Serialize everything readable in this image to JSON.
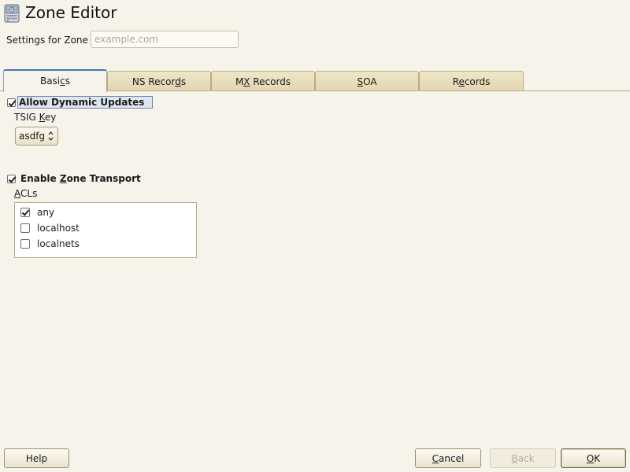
{
  "app": {
    "title": "Zone Editor",
    "icon": "server-icon"
  },
  "zone": {
    "label": "Settings for Zone",
    "placeholder": "example.com",
    "value": ""
  },
  "tabs": [
    {
      "pre": "Basi",
      "key": "c",
      "post": "s",
      "active": true
    },
    {
      "pre": "NS Recor",
      "key": "d",
      "post": "s",
      "active": false
    },
    {
      "pre": "M",
      "key": "X",
      "post": " Records",
      "active": false
    },
    {
      "pre": "",
      "key": "S",
      "post": "OA",
      "active": false
    },
    {
      "pre": "R",
      "key": "e",
      "post": "cords",
      "active": false
    }
  ],
  "dynamic_updates": {
    "label": "Allow Dynamic Updates",
    "checked": true
  },
  "tsig": {
    "label_pre": "TSIG ",
    "label_key": "K",
    "label_post": "ey",
    "selected": "asdfg"
  },
  "zone_transport": {
    "label_pre": "Enable ",
    "label_key": "Z",
    "label_post": "one Transport",
    "checked": true
  },
  "acls": {
    "label_key": "A",
    "label_post": "CLs",
    "items": [
      {
        "label": "any",
        "checked": true
      },
      {
        "label": "localhost",
        "checked": false
      },
      {
        "label": "localnets",
        "checked": false
      }
    ]
  },
  "buttons": {
    "help": "Help",
    "cancel_key": "C",
    "cancel_rest": "ancel",
    "back_key": "B",
    "back_rest": "ack",
    "ok_key": "O",
    "ok_rest": "K"
  }
}
